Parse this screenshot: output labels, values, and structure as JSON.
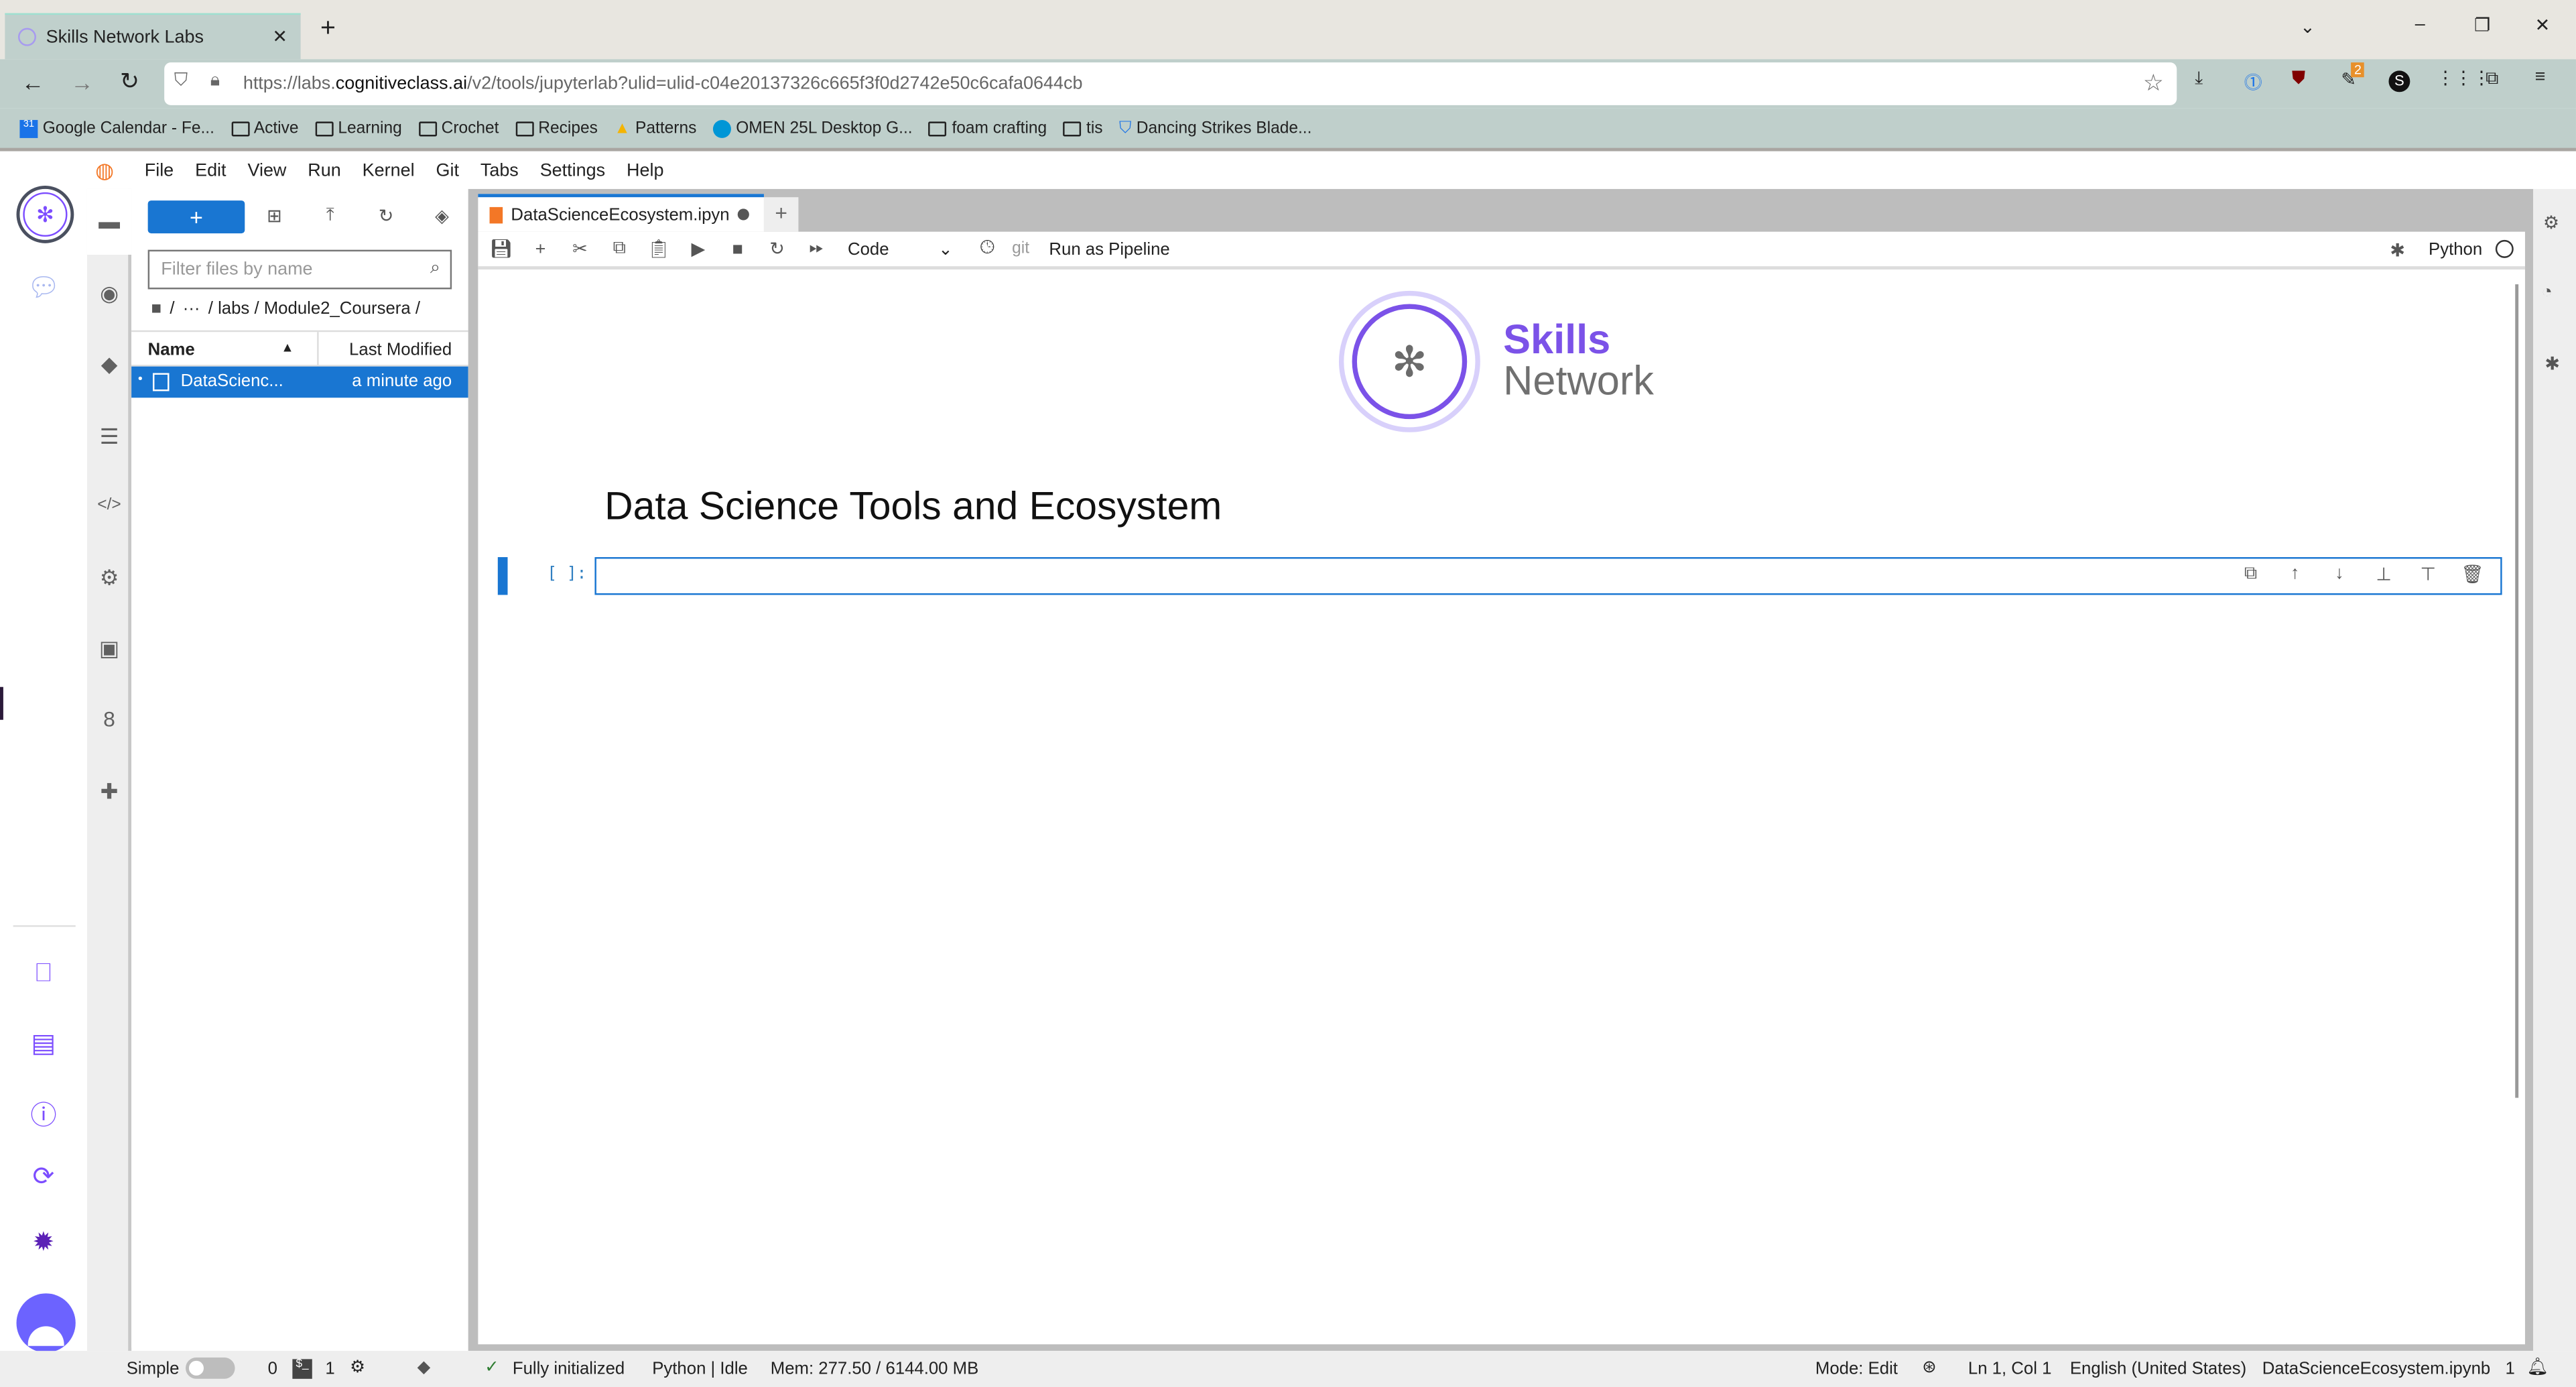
{
  "browser": {
    "tab_title": "Skills Network Labs",
    "url_prefix": "https://labs.",
    "url_domain": "cognitiveclass.ai",
    "url_path": "/v2/tools/jupyterlab?ulid=ulid-c04e20137326c665f3f0d2742e50c6cafa0644cb",
    "extension_badge": "2",
    "bookmarks": [
      "Google Calendar - Fe...",
      "Active",
      "Learning",
      "Crochet",
      "Recipes",
      "Patterns",
      "OMEN 25L Desktop G...",
      "foam crafting",
      "tis",
      "Dancing Strikes Blade..."
    ]
  },
  "menu": [
    "File",
    "Edit",
    "View",
    "Run",
    "Kernel",
    "Git",
    "Tabs",
    "Settings",
    "Help"
  ],
  "filebrowser": {
    "new_label": "+",
    "filter_placeholder": "Filter files by name",
    "breadcrumb": [
      "/",
      "···",
      "/ labs / Module2_Coursera /"
    ],
    "col_name": "Name",
    "col_modified": "Last Modified",
    "files": [
      {
        "name": "DataScienc...",
        "modified": "a minute ago"
      }
    ]
  },
  "notebook": {
    "tab_title": "DataScienceEcosystem.ipyn",
    "cell_type": "Code",
    "git_label": "git",
    "pipeline_label": "Run as Pipeline",
    "kernel": "Python",
    "logo_skills": "Skills",
    "logo_network": "Network",
    "heading": "Data Science Tools and Ecosystem",
    "prompt": "[ ]:"
  },
  "status": {
    "simple": "Simple",
    "terminals": "0",
    "kernels": "1",
    "init": "Fully initialized",
    "kernel_state": "Python | Idle",
    "mem": "Mem: 277.50 / 6144.00 MB",
    "mode": "Mode: Edit",
    "pos": "Ln 1, Col 1",
    "lang": "English (United States)",
    "file": "DataScienceEcosystem.ipynb",
    "notif": "1"
  },
  "colors": {
    "accent": "#1976d2",
    "brand": "#7b52e8"
  }
}
